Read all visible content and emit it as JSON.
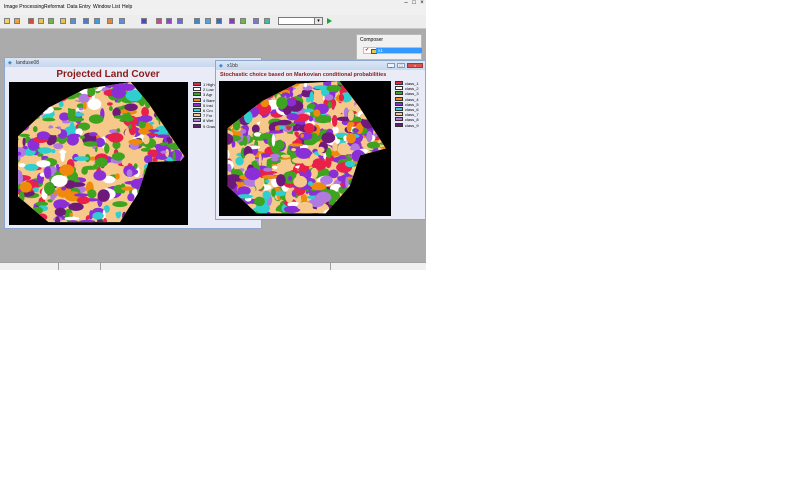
{
  "menubar": {
    "items": [
      "Image Processing",
      "Reformat",
      "Data Entry",
      "Window List",
      "Help"
    ]
  },
  "window_controls": [
    "–",
    "□",
    "×"
  ],
  "toolbar": {
    "icons": [
      "digitize-icon",
      "raster-icon",
      "vector-icon",
      "group-icon",
      "layer-icon",
      "display-icon",
      "query-icon",
      "zoom-icon",
      "pan-icon",
      "palette-icon",
      "measure-icon",
      "histogram-icon",
      "georef-icon",
      "chart-icon",
      "table-icon",
      "edit-icon",
      "export-icon",
      "settings-icon",
      "flow-icon",
      "model-icon",
      "macro-icon"
    ]
  },
  "composer": {
    "title": "Composer",
    "layer": "x1"
  },
  "landuse_window": {
    "title": "landuse08",
    "map_title": "Projected Land Cover",
    "legend": [
      {
        "label": "1 High",
        "color": "#e8204a"
      },
      {
        "label": "2 Low",
        "color": "#ffffff"
      },
      {
        "label": "3 Agr",
        "color": "#3ea31f"
      },
      {
        "label": "4 Bare",
        "color": "#f08a0c"
      },
      {
        "label": "5 Inst",
        "color": "#8a2fd8"
      },
      {
        "label": "6 Cro",
        "color": "#2fcfcf"
      },
      {
        "label": "7 For",
        "color": "#f6c98b"
      },
      {
        "label": "8 Wet",
        "color": "#b07ae0"
      },
      {
        "label": "9 Gras",
        "color": "#6e1a7a"
      }
    ]
  },
  "x_window": {
    "title": "x1bb",
    "map_title": "Stochastic choice based on Markovian conditional probabilities",
    "legend": [
      {
        "label": "class_1",
        "color": "#e8204a"
      },
      {
        "label": "class_2",
        "color": "#ffffff"
      },
      {
        "label": "class_3",
        "color": "#3ea31f"
      },
      {
        "label": "class_4",
        "color": "#f08a0c"
      },
      {
        "label": "class_5",
        "color": "#8a2fd8"
      },
      {
        "label": "class_6",
        "color": "#2fcfcf"
      },
      {
        "label": "class_7",
        "color": "#f6c98b"
      },
      {
        "label": "class_8",
        "color": "#b07ae0"
      },
      {
        "label": "class_9",
        "color": "#6e1a7a"
      }
    ]
  }
}
